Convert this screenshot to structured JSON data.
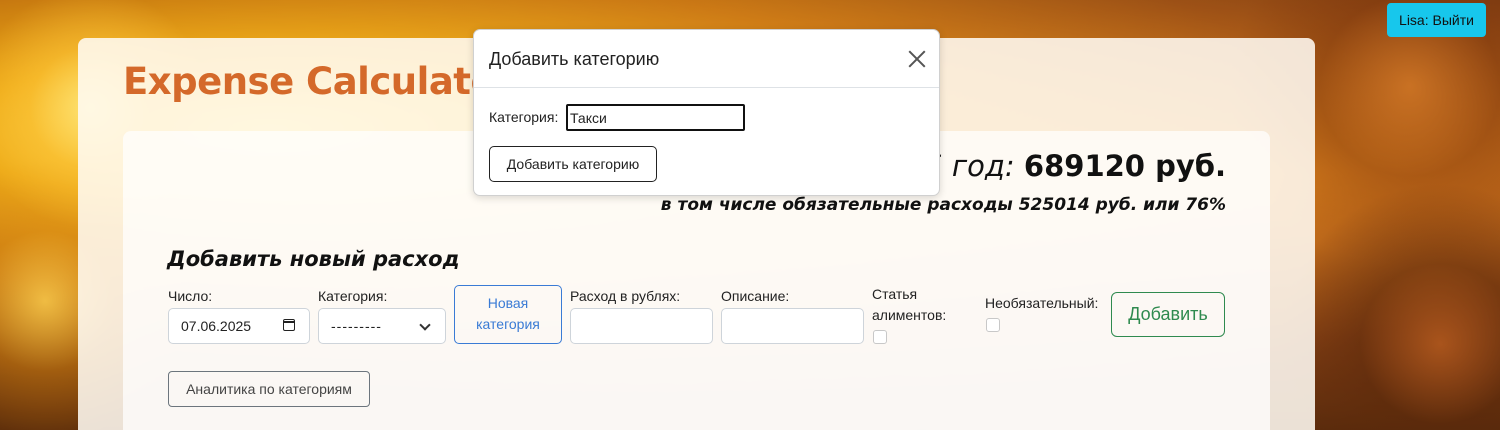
{
  "header": {
    "logout_label": "Lisa: Выйти"
  },
  "app": {
    "title": "Expense Calculator"
  },
  "summary": {
    "total_label": "025 год:",
    "total_value": "689120 руб.",
    "required_line": "в том числе обязательные расходы 525014 руб. или 76%"
  },
  "form": {
    "section_title": "Добавить новый расход",
    "date_label": "Число:",
    "date_value": "07.06.2025",
    "category_label": "Категория:",
    "category_value": "---------",
    "new_category_line1": "Новая",
    "new_category_line2": "категория",
    "amount_label": "Расход в рублях:",
    "amount_value": "",
    "description_label": "Описание:",
    "description_value": "",
    "alimony_label_line1": "Статья",
    "alimony_label_line2": "алиментов:",
    "optional_label": "Необязательный:",
    "add_label": "Добавить",
    "analytics_label": "Аналитика по категориям"
  },
  "modal": {
    "title": "Добавить категорию",
    "category_label": "Категория:",
    "category_value": "Такси",
    "submit_label": "Добавить категорию"
  },
  "colors": {
    "title_accent": "#d4692a",
    "logout_bg": "#17c7ec",
    "primary_outline": "#3a7bd5",
    "success_outline": "#2f8a4f"
  }
}
